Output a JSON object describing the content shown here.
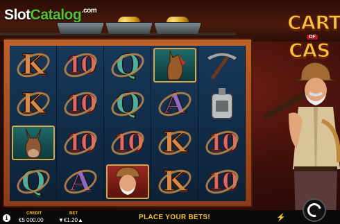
{
  "watermark": {
    "part_a": "Slot",
    "part_b": "Catalog",
    "suffix": ".com"
  },
  "game_title": {
    "line1": "CART",
    "line2": "OF",
    "line3": "CAS"
  },
  "reels": [
    [
      "K",
      "K",
      "mule",
      "Q"
    ],
    [
      "10",
      "10",
      "10",
      "A"
    ],
    [
      "Q",
      "Q",
      "10",
      "miner"
    ],
    [
      "horse",
      "A",
      "K",
      "K"
    ],
    [
      "pickaxe",
      "flask",
      "10",
      "10"
    ]
  ],
  "status_message": "PLACE YOUR BETS!",
  "credit": {
    "label": "CREDIT",
    "value": "€5 000.00"
  },
  "bet": {
    "label": "BET",
    "value": "€1.20"
  },
  "icons": [
    "info-icon",
    "bolt-icon",
    "spin-icon",
    "minecart-icon"
  ],
  "colors": {
    "accent": "#f2c230",
    "frame": "#c0612a",
    "reel_bg": "#102a45"
  }
}
